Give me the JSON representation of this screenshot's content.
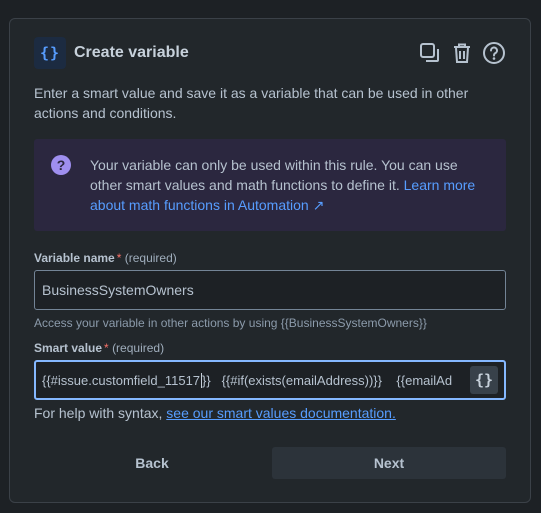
{
  "header": {
    "icon": "curly-braces-icon",
    "icon_glyph": "{}",
    "title": "Create variable",
    "actions": [
      "copy-icon",
      "trash-icon",
      "help-icon"
    ]
  },
  "description": "Enter a smart value and save it as a variable that can be used in other actions and conditions.",
  "info": {
    "icon": "question-icon",
    "text": "Your variable can only be used within this rule. You can use other smart values and math functions to define it. ",
    "link": "Learn more about math functions in Automation ↗"
  },
  "variable_name": {
    "label": "Variable name",
    "required_mark": "*",
    "required_text": "(required)",
    "value": "BusinessSystemOwners",
    "helper": "Access your variable in other actions by using {{BusinessSystemOwners}}"
  },
  "smart_value": {
    "label": "Smart value",
    "required_mark": "*",
    "required_text": "(required)",
    "value_before_caret": "{{#issue.customfield_11517",
    "value_after_caret": "}}   {{#if(exists(emailAddress))}}    {{emailAd",
    "button_glyph": "{}"
  },
  "syntax_help": {
    "text": "For help with syntax, ",
    "link": "see our smart values documentation."
  },
  "footer": {
    "back_label": "Back",
    "next_label": "Next"
  },
  "colors": {
    "accent": "#579dff",
    "discovery": "#9f8fef",
    "required": "#f87168"
  }
}
